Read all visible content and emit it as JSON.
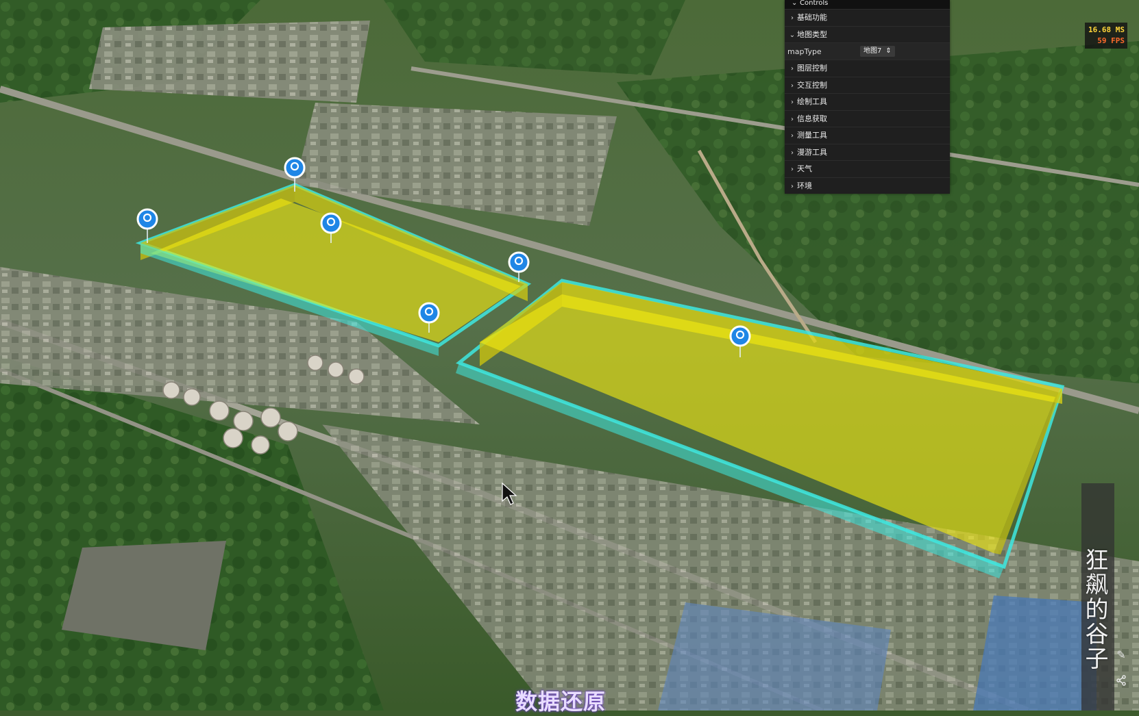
{
  "controls": {
    "title": "Controls",
    "folders": [
      {
        "label": "基础功能",
        "open": false
      },
      {
        "label": "地图类型",
        "open": true
      },
      {
        "label": "图层控制",
        "open": false
      },
      {
        "label": "交互控制",
        "open": false
      },
      {
        "label": "绘制工具",
        "open": false
      },
      {
        "label": "信息获取",
        "open": false
      },
      {
        "label": "测量工具",
        "open": false
      },
      {
        "label": "漫游工具",
        "open": false
      },
      {
        "label": "天气",
        "open": false
      },
      {
        "label": "环境",
        "open": false
      }
    ],
    "map_type": {
      "label": "mapType",
      "value": "地图7"
    }
  },
  "stats": {
    "ms": "16.68 MS",
    "fps": "59 FPS"
  },
  "watermark": "狂飙的谷子",
  "subtitle": "数据还原",
  "icons": [
    "pen-icon",
    "share-icon",
    "chevron-down-icon",
    "location-pin-icon",
    "mouse-cursor-icon"
  ],
  "colors": {
    "zone_fill": "#f2ea12",
    "zone_outline": "#3ee8e0",
    "pin": "#1f86e6",
    "panel_bg": "#1c1c1c"
  }
}
